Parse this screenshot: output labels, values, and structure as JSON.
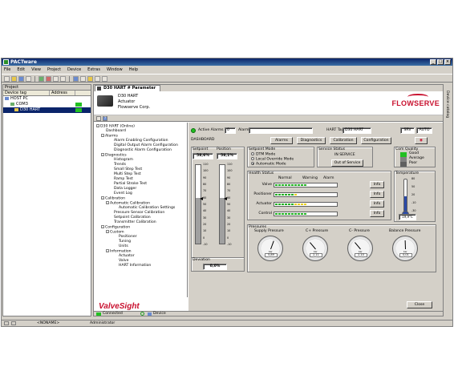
{
  "app": {
    "title": "PACTware"
  },
  "menu": [
    "File",
    "Edit",
    "View",
    "Project",
    "Device",
    "Extras",
    "Window",
    "Help"
  ],
  "project_pane": {
    "title": "Project",
    "columns": [
      "Device tag",
      "Address"
    ],
    "tree": [
      {
        "label": "HOST PC"
      },
      {
        "label": "COM3"
      },
      {
        "label": "D30 HART"
      }
    ]
  },
  "device_tab": {
    "label": "D30 HART # Parameter"
  },
  "device_header": {
    "lines": [
      "D30 HART",
      "Actuator",
      "Flowserve Corp."
    ],
    "logo": "FLOWSERVE"
  },
  "nav_tree": [
    "D30 HART (Online)",
    "Dashboard",
    "Alarms",
    "Alarm Enabling Configuration",
    "Digital Output Alarm Configuration",
    "Diagnostic Alarm Configuration",
    "Diagnostics",
    "Histogram",
    "Trends",
    "Small Step Test",
    "Multi Step Test",
    "Ramp Test",
    "Partial Stroke Test",
    "Data Logger",
    "Event Log",
    "Calibration",
    "Automatic Calibration",
    "Automatic Calibration Settings",
    "Pressure Sensor Calibration",
    "Setpoint Calibration",
    "Transmitter Calibration",
    "Configuration",
    "Custom",
    "Positioner",
    "Tuning",
    "Units",
    "Information",
    "Actuator",
    "Valve",
    "HART Information"
  ],
  "branding": {
    "valvesight": "ValveSight"
  },
  "dashboard": {
    "active_alarms_label": "Active Alarms",
    "active_alarms_value": "0",
    "alarm_label": "Alarm",
    "hart_tag_label": "HART Tag",
    "hart_tag_value": "D30 HART",
    "srv": "SRV",
    "auto": "AUTO",
    "section_label": "DASHBOARD",
    "buttons": [
      "Alarms",
      "Diagnostics",
      "Calibration",
      "Configuration"
    ],
    "setpoint_label": "Setpoint",
    "setpoint_value": "58,6%",
    "position_label": "Position",
    "position_value": "58,1%",
    "setpoint_level": 0.586,
    "position_level": 0.581,
    "gauge_scale": [
      "110",
      "100",
      "90",
      "80",
      "70",
      "60",
      "50",
      "40",
      "30",
      "20",
      "10",
      "0",
      "-10"
    ],
    "deviation_label": "Deviation",
    "deviation_value": "0,0%",
    "setpoint_mode": {
      "title": "Setpoint Mode",
      "options": [
        "DTM Mode",
        "Local Override Mode",
        "Automatic Mode"
      ],
      "selected": 2
    },
    "service_status": {
      "title": "Service Status",
      "value": "IN SERVICE",
      "button": "Out of Service"
    },
    "comm_quality": {
      "title": "Com Quality",
      "levels": [
        "Good",
        "Average",
        "Poor"
      ]
    },
    "temperature": {
      "title": "Temperature",
      "scale": [
        "80",
        "50",
        "20",
        "-10",
        "-30"
      ],
      "value": "19,9°C",
      "level": 0.45
    },
    "health": {
      "title": "Health Status",
      "columns": [
        "Normal",
        "Warning",
        "Alarm"
      ],
      "rows": [
        {
          "label": "Valve",
          "green": 10,
          "yellow": 0
        },
        {
          "label": "Positioner",
          "green": 6,
          "yellow": 1
        },
        {
          "label": "Actuator",
          "green": 6,
          "yellow": 4
        },
        {
          "label": "Control",
          "green": 10,
          "yellow": 0
        }
      ],
      "info_label": "Info"
    },
    "pressures": {
      "title": "Pressures",
      "dials": [
        {
          "label": "Supply Pressure",
          "value": "5,89",
          "unit": "bar",
          "angle": 20
        },
        {
          "label": "C+ Pressure",
          "value": "2,11",
          "unit": "bar",
          "angle": -40
        },
        {
          "label": "C- Pressure",
          "value": "2,10",
          "unit": "bar",
          "angle": -40
        },
        {
          "label": "Balance Pressure",
          "value": "0,01",
          "unit": "bar",
          "angle": -2
        }
      ]
    },
    "close_button": "Close"
  },
  "statusbar": {
    "connected": "Connected",
    "device": "Device",
    "noname": "<NONAME>",
    "user": "Administrator"
  },
  "right_dock": {
    "label": "Device catalog"
  }
}
